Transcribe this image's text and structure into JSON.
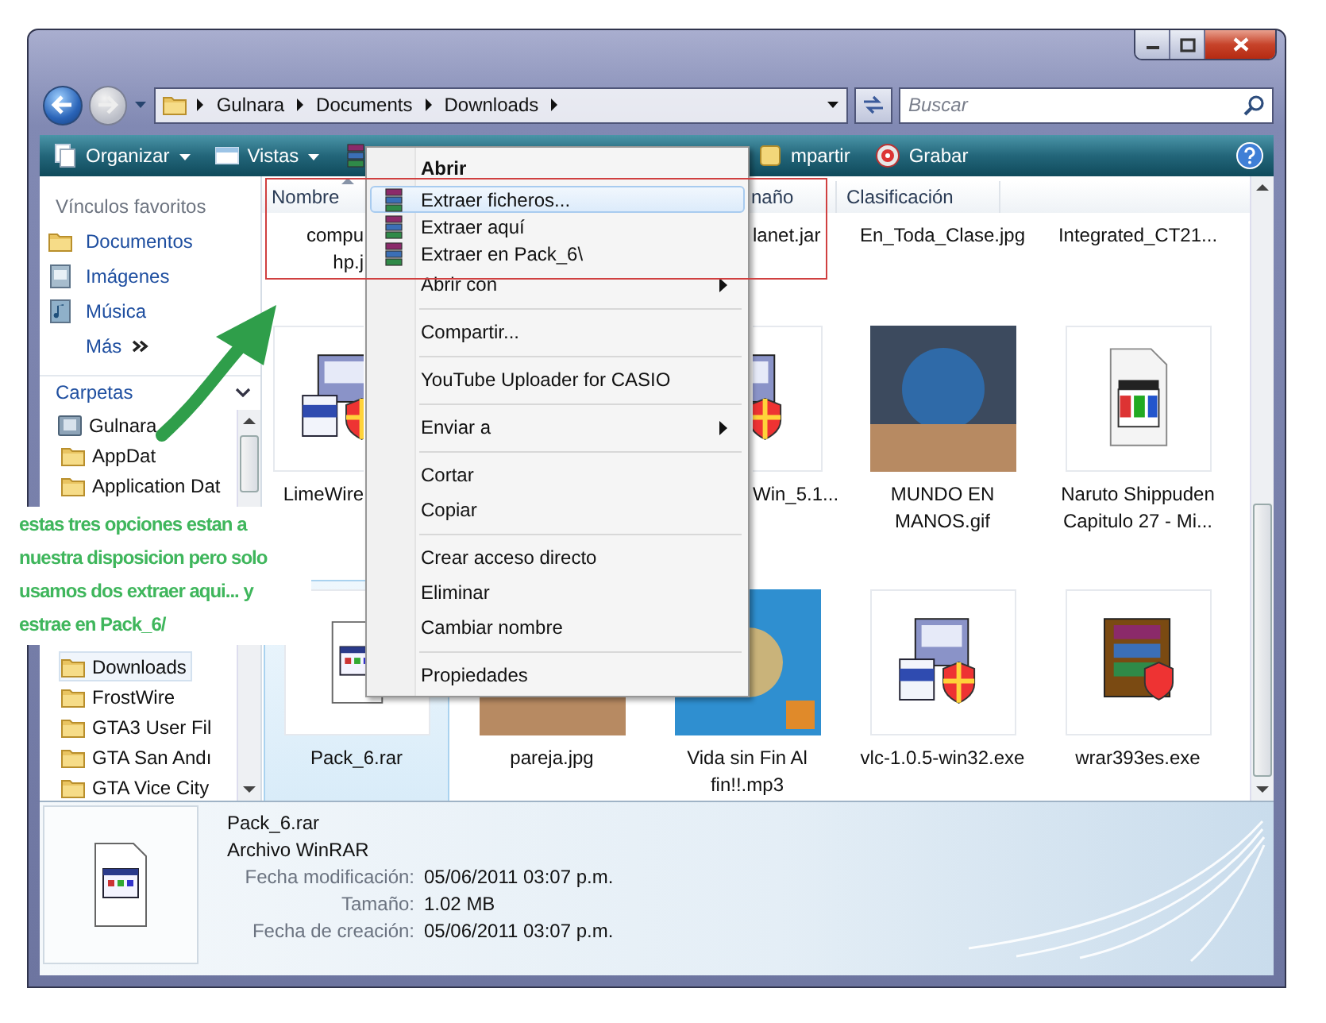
{
  "address_bar": {
    "crumbs": [
      "Gulnara",
      "Documents",
      "Downloads"
    ]
  },
  "search": {
    "placeholder": "Buscar"
  },
  "toolbar": {
    "items": [
      {
        "label": "Organizar",
        "kind": "organize",
        "dropdown": true,
        "clipped_left": false
      },
      {
        "label": "Vistas",
        "kind": "views",
        "dropdown": true,
        "clipped_left": false
      },
      {
        "kind": "archive",
        "dropdown": false,
        "clipped_left": false
      },
      {
        "label": "mpartir",
        "kind": "share",
        "dropdown": false,
        "clipped_left": true
      },
      {
        "label": "Grabar",
        "kind": "burn",
        "dropdown": false,
        "clipped_left": false
      }
    ]
  },
  "sidebar": {
    "favorites_title": "Vínculos favoritos",
    "favorites": [
      {
        "label": "Documentos",
        "kind": "folder"
      },
      {
        "label": "Imágenes",
        "kind": "pictures"
      },
      {
        "label": "Música",
        "kind": "music"
      },
      {
        "label": "Más",
        "kind": "more"
      }
    ],
    "folders_title": "Carpetas",
    "tree": [
      {
        "label": "Gulnara",
        "kind": "user",
        "selected": false,
        "children": [
          {
            "label": "AppDat",
            "kind": "folder",
            "selected": false
          },
          {
            "label": "Application Dat",
            "kind": "folder",
            "selected": false
          },
          {
            "label": "Downloads",
            "kind": "folder",
            "selected": true
          },
          {
            "label": "FrostWire",
            "kind": "folder",
            "selected": false
          },
          {
            "label": "GTA3 User Fil",
            "kind": "folder",
            "selected": false
          },
          {
            "label": "GTA San Andı",
            "kind": "folder",
            "selected": false
          },
          {
            "label": "GTA Vice City",
            "kind": "folder",
            "selected": false
          }
        ]
      }
    ]
  },
  "columns": [
    {
      "label": "Nombre",
      "sorted": true,
      "clipped_left": false
    },
    {
      "label": "naño",
      "sorted": false,
      "clipped_left": true
    },
    {
      "label": "Clasificación",
      "sorted": false,
      "clipped_left": false
    }
  ],
  "files": {
    "rows": [
      {
        "tiles": [
          {
            "lines": [
              "compu",
              "hp.j"
            ],
            "selected": false,
            "clipped_left": false,
            "clipped_right": true
          },
          {
            "lines": [
              "lanet.jar"
            ],
            "selected": false,
            "clipped_left": true,
            "clipped_right": false
          },
          {
            "lines": [
              "En_Toda_Clase.jpg"
            ],
            "selected": false,
            "clipped_left": false,
            "clipped_right": false
          },
          {
            "lines": [
              "Integrated_CT21..."
            ],
            "selected": false,
            "clipped_left": false,
            "clipped_right": false
          }
        ]
      },
      {
        "tiles": [
          {
            "lines": [
              "LimeWire"
            ],
            "kind": "installer",
            "selected": false,
            "clipped_left": false,
            "clipped_right": true
          },
          {
            "lines": [
              "Win_5.1..."
            ],
            "kind": "installer",
            "selected": false,
            "clipped_left": true,
            "clipped_right": false
          },
          {
            "lines": [
              "MUNDO EN",
              "MANOS.gif"
            ],
            "kind": "photo",
            "selected": false,
            "clipped_left": false,
            "clipped_right": false
          },
          {
            "lines": [
              "Naruto Shippuden",
              "Capitulo 27 - Mi..."
            ],
            "kind": "video",
            "selected": false,
            "clipped_left": false,
            "clipped_right": false
          }
        ]
      },
      {
        "tiles": [
          {
            "lines": [
              "Pack_6.rar"
            ],
            "kind": "archive",
            "selected": true,
            "clipped_left": false,
            "clipped_right": false
          },
          {
            "lines": [
              "pareja.jpg"
            ],
            "kind": "photo",
            "selected": false,
            "clipped_left": false,
            "clipped_right": false
          },
          {
            "lines": [
              "Vida sin Fin Al",
              "fin!!.mp3"
            ],
            "kind": "audio",
            "selected": false,
            "clipped_left": false,
            "clipped_right": false
          },
          {
            "lines": [
              "vlc-1.0.5-win32.exe"
            ],
            "kind": "installer",
            "selected": false,
            "clipped_left": false,
            "clipped_right": false
          },
          {
            "lines": [
              "wrar393es.exe"
            ],
            "kind": "archive-installer",
            "selected": false,
            "clipped_left": false,
            "clipped_right": false
          }
        ]
      }
    ]
  },
  "details": {
    "name": "Pack_6.rar",
    "kind": "archive",
    "type": "Archivo WinRAR",
    "properties": [
      {
        "label": "Fecha modificación:",
        "value": "05/06/2011 03:07 p.m."
      },
      {
        "label": "Tamaño:",
        "value": "1.02 MB"
      },
      {
        "label": "Fecha de creación:",
        "value": "05/06/2011 03:07 p.m."
      }
    ]
  },
  "context_menu": {
    "items": [
      {
        "label": "Abrir",
        "kind": "default",
        "selected": false,
        "submenu": false,
        "separator_before": false
      },
      {
        "label": "Extraer ficheros...",
        "kind": "archive",
        "selected": true,
        "submenu": false,
        "separator_before": false
      },
      {
        "label": "Extraer aquí",
        "kind": "archive",
        "selected": false,
        "submenu": false,
        "separator_before": false
      },
      {
        "label": "Extraer en Pack_6\\",
        "kind": "archive",
        "selected": false,
        "submenu": false,
        "separator_before": false
      },
      {
        "label": "Abrir con",
        "kind": "plain",
        "selected": false,
        "submenu": true,
        "separator_before": false
      },
      {
        "label": "Compartir...",
        "kind": "plain",
        "selected": false,
        "submenu": false,
        "separator_before": true
      },
      {
        "label": "YouTube Uploader for CASIO",
        "kind": "plain",
        "selected": false,
        "submenu": false,
        "separator_before": true
      },
      {
        "label": "Enviar a",
        "kind": "plain",
        "selected": false,
        "submenu": true,
        "separator_before": true
      },
      {
        "label": "Cortar",
        "kind": "plain",
        "selected": false,
        "submenu": false,
        "separator_before": true
      },
      {
        "label": "Copiar",
        "kind": "plain",
        "selected": false,
        "submenu": false,
        "separator_before": false
      },
      {
        "label": "Crear acceso directo",
        "kind": "plain",
        "selected": false,
        "submenu": false,
        "separator_before": true
      },
      {
        "label": "Eliminar",
        "kind": "plain",
        "selected": false,
        "submenu": false,
        "separator_before": false
      },
      {
        "label": "Cambiar nombre",
        "kind": "plain",
        "selected": false,
        "submenu": false,
        "separator_before": false
      },
      {
        "label": "Propiedades",
        "kind": "plain",
        "selected": false,
        "submenu": false,
        "separator_before": true
      }
    ]
  },
  "annotation": {
    "text": "estas tres opciones estan a nuestra disposicion pero solo usamos dos extraer aqui... y estrae en Pack_6/"
  }
}
